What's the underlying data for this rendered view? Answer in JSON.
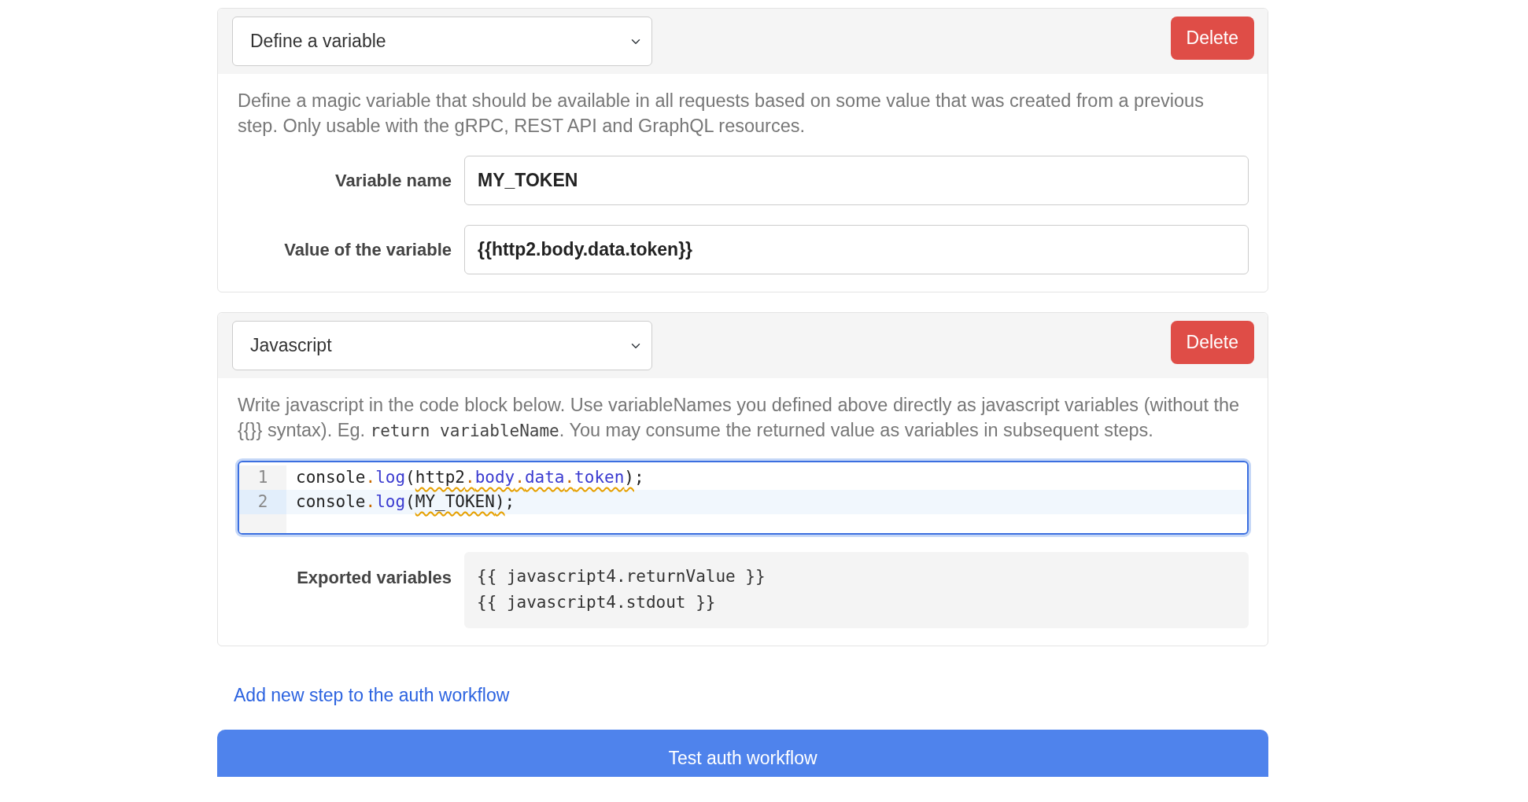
{
  "steps": [
    {
      "kind": "variable",
      "type_select": {
        "value": "Define a variable"
      },
      "delete_button": "Delete",
      "description": [
        {
          "kind": "text",
          "text": "Define a magic variable that should be available in all requests based on some value that was created from a previous step. Only usable with the gRPC, REST API and GraphQL resources."
        }
      ],
      "fields": [
        {
          "label": "Variable name",
          "value": "MY_TOKEN"
        },
        {
          "label": "Value of the variable",
          "value": "{{http2.body.data.token}}"
        }
      ]
    },
    {
      "kind": "javascript",
      "type_select": {
        "value": "Javascript"
      },
      "delete_button": "Delete",
      "description": [
        {
          "kind": "text",
          "text": "Write javascript in the code block below. Use variableNames you defined above directly as javascript variables (without the {{}} syntax). Eg. "
        },
        {
          "kind": "code",
          "text": "return variableName"
        },
        {
          "kind": "text",
          "text": ". You may consume the returned value as variables in subsequent steps."
        }
      ],
      "code_editor": {
        "focused": true,
        "lines": [
          {
            "number": "1",
            "code": "console.log(http2.body.data.token);",
            "active": false,
            "lint_warning": true
          },
          {
            "number": "2",
            "code": "console.log(MY_TOKEN);",
            "active": true,
            "lint_warning": true
          }
        ]
      },
      "exported": {
        "label": "Exported variables",
        "values": [
          "{{ javascript4.returnValue }}",
          "{{ javascript4.stdout }}"
        ]
      }
    }
  ],
  "add_step_link": "Add new step to the auth workflow",
  "test_button": "Test auth workflow"
}
